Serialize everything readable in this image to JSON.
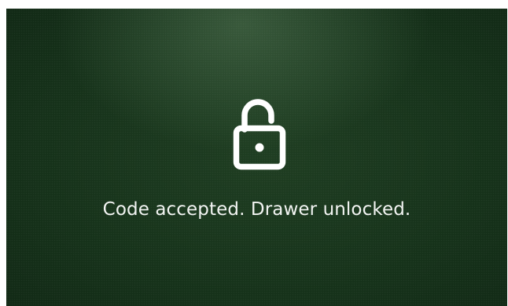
{
  "screen": {
    "icon": "unlocked-padlock-icon",
    "message": "Code accepted. Drawer unlocked.",
    "colors": {
      "background": "#16321a",
      "foreground": "#ffffff"
    }
  }
}
